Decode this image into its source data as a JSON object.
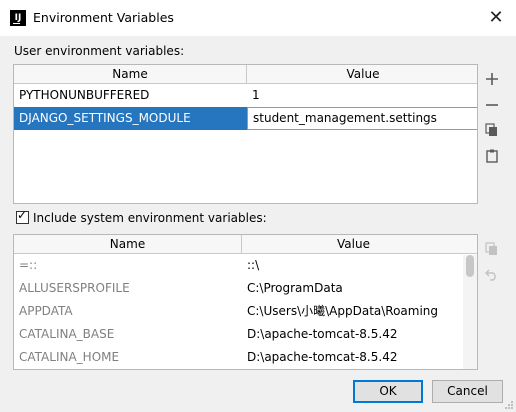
{
  "window": {
    "title": "Environment Variables",
    "app_icon_label": "IJ"
  },
  "user_section": {
    "label": "User environment variables:",
    "columns": [
      "Name",
      "Value"
    ],
    "rows": [
      {
        "name": "PYTHONUNBUFFERED",
        "value": "1"
      },
      {
        "name": "DJANGO_SETTINGS_MODULE",
        "value": "student_management.settings"
      }
    ],
    "selected_row": 1
  },
  "user_toolbar": [
    "add-icon",
    "remove-icon",
    "copy-icon",
    "paste-icon"
  ],
  "system_section": {
    "label": "Include system environment variables:",
    "checked": true,
    "columns": [
      "Name",
      "Value"
    ],
    "rows": [
      {
        "name": "=::",
        "value": "::\\"
      },
      {
        "name": "ALLUSERSPROFILE",
        "value": "C:\\ProgramData"
      },
      {
        "name": "APPDATA",
        "value": "C:\\Users\\小曦\\AppData\\Roaming"
      },
      {
        "name": "CATALINA_BASE",
        "value": "D:\\apache-tomcat-8.5.42"
      },
      {
        "name": "CATALINA_HOME",
        "value": "D:\\apache-tomcat-8.5.42"
      }
    ]
  },
  "system_toolbar": [
    "copy-icon",
    "undo-icon"
  ],
  "buttons": {
    "ok": "OK",
    "cancel": "Cancel"
  }
}
